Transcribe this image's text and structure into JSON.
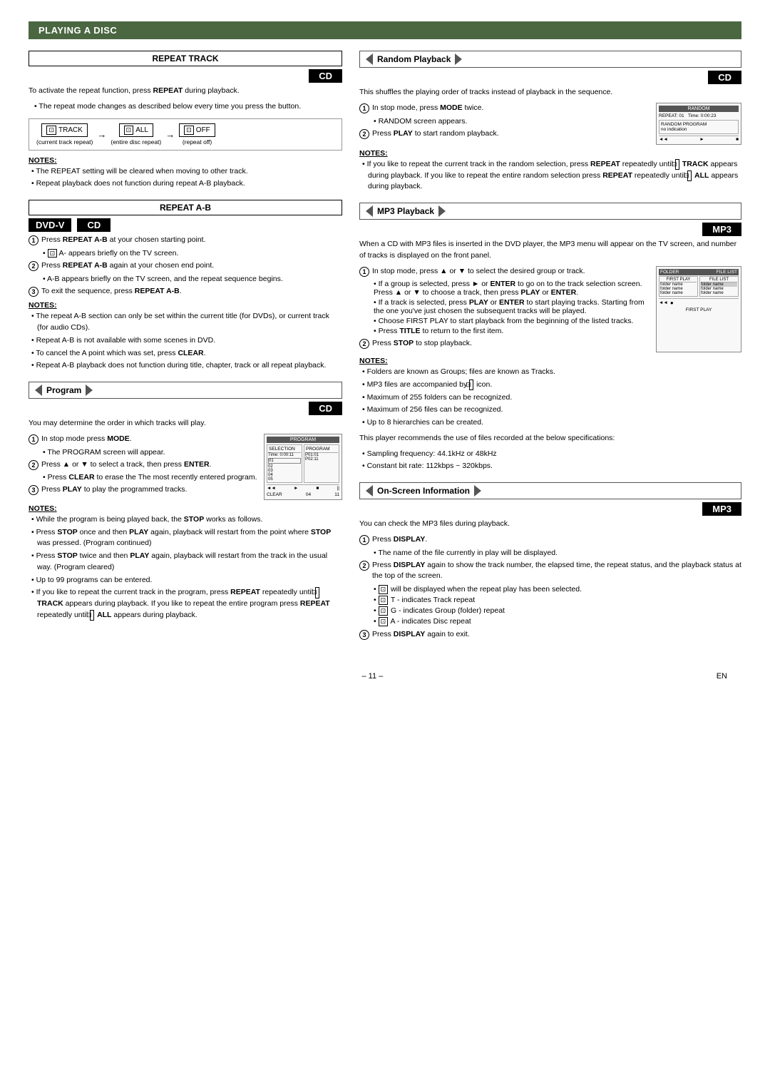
{
  "page": {
    "title": "PLAYING A DISC",
    "footer": "– 11 –",
    "footer_lang": "EN"
  },
  "left_col": {
    "repeat_track": {
      "header": "REPEAT TRACK",
      "badge": "CD",
      "intro": "To activate the repeat function, press REPEAT during playback.",
      "bullet1": "The repeat mode changes as described below every time you press the button.",
      "diagram": {
        "item1_icon": "⊡",
        "item1_label": "TRACK",
        "item1_sub": "(current track repeat)",
        "arrow1": "→",
        "item2_icon": "⊡",
        "item2_label": "ALL",
        "item2_sub": "(entire disc repeat)",
        "arrow2": "→",
        "item3_icon": "⊡",
        "item3_label": "OFF",
        "item3_sub": "(repeat off)"
      },
      "notes_label": "NOTES:",
      "note1": "The REPEAT setting will be cleared when moving to other track.",
      "note2": "Repeat playback does not function during repeat A-B playback."
    },
    "repeat_ab": {
      "header": "REPEAT A-B",
      "badges": [
        "DVD-V",
        "CD"
      ],
      "step1": "Press REPEAT A-B at your chosen starting point.",
      "step1b": "⊡ A- appears briefly on the TV screen.",
      "step2": "Press REPEAT A-B again at your chosen end point.",
      "step2b": "A-B appears briefly on the TV screen, and the repeat sequence begins.",
      "step3": "To exit the sequence, press REPEAT A-B.",
      "notes_label": "NOTES:",
      "note1": "The repeat A-B section can only be set within the current title (for DVDs), or current track (for audio CDs).",
      "note2": "Repeat A-B is not available with some scenes in DVD.",
      "note3": "To cancel the A point which was set, press CLEAR.",
      "note4": "Repeat A-B playback does not function during title, chapter, track or all repeat playback."
    },
    "program": {
      "header": "Program",
      "badge": "CD",
      "intro": "You may determine the order in which tracks will play.",
      "step1": "In stop mode press MODE.",
      "step1b": "The PROGRAM screen will appear.",
      "step2": "Press ▲ or ▼ to select a track, then press ENTER.",
      "step2b": "Press CLEAR to erase the The most recently entered program.",
      "step3": "Press PLAY to play the programmed tracks.",
      "notes_label": "NOTES:",
      "note1": "While the program is being played back, the STOP works as follows.",
      "note2": "Press STOP once and then PLAY again, playback will restart from the point where STOP was pressed. (Program continued)",
      "note3": "Press STOP twice and then PLAY again, playback will restart from the track in the usual way. (Program cleared)",
      "note4": "Up to 99 programs can be entered.",
      "note5": "If you like to repeat the current track in the program, press REPEAT repeatedly until ⊡ TRACK appears during playback. If you like to repeat the entire program press REPEAT repeatedly until ⊡ ALL appears during playback."
    }
  },
  "right_col": {
    "random_playback": {
      "header": "Random Playback",
      "badge": "CD",
      "intro": "This shuffles the playing order of tracks instead of playback in the sequence.",
      "step1": "In stop mode, press MODE twice.",
      "step1b": "RANDOM screen appears.",
      "step2": "Press PLAY to start random playback.",
      "notes_label": "NOTES:",
      "note1": "If you like to repeat the current track in the random selection, press REPEAT repeatedly until ⊡ TRACK appears during playback. If you like to repeat the entire random selection press REPEAT repeatedly until ⊡ ALL appears during playback.",
      "screen": {
        "line1": "RANDOM",
        "line2": "REPEAT: 01  Time: 0:00:23",
        "line3": "RANDOM PROGRAM",
        "line4": "no indication"
      }
    },
    "mp3_playback": {
      "header": "MP3 Playback",
      "badge": "MP3",
      "intro": "When a CD with MP3 files is inserted in the DVD player, the MP3 menu will appear on the TV screen, and number of tracks is displayed on the front panel.",
      "step1": "In stop mode, press ▲ or ▼ to select the desired group or track.",
      "step1_bullets": [
        "If a group is selected, press ► or ENTER to go on to the track selection screen. Press ▲ or ▼ to choose a track, then press PLAY or ENTER.",
        "If a track is selected, press PLAY or ENTER to start playing tracks. Starting from the one you've just chosen the subsequent tracks will be played.",
        "Choose FIRST PLAY to start playback from the beginning of the listed tracks.",
        "Press TITLE to return to the first item."
      ],
      "step2": "Press STOP to stop playback.",
      "notes_label": "NOTES:",
      "notes": [
        "Folders are known as Groups; files are known as Tracks.",
        "MP3 files are accompanied by ⊡ icon.",
        "Maximum of 255 folders can be recognized.",
        "Maximum of 256 files can be recognized.",
        "Up to 8 hierarchies can be created."
      ],
      "spec_intro": "This player recommends the use of files recorded at the below specifications:",
      "spec1": "Sampling frequency: 44.1kHz or 48kHz",
      "spec2": "Constant bit rate: 112kbps ~ 320kbps.",
      "screen": {
        "header_left": "FOLDER",
        "header_right": "FILE LIST",
        "row1": "FIRST PLAY",
        "rows": [
          "folder name",
          "folder name",
          "folder name"
        ],
        "file_rows": [
          "folder name",
          "folder name",
          "folder name"
        ],
        "footer": "FIRST PLAY"
      }
    },
    "onscreen_info": {
      "header": "On-Screen Information",
      "badge": "MP3",
      "intro": "You can check the MP3 files during playback.",
      "step1": "Press DISPLAY.",
      "step1b": "The name of the file currently in play will be displayed.",
      "step2": "Press DISPLAY again to show the track number, the elapsed time, the repeat status, and the playback status at the top of the screen.",
      "step2_bullets": [
        "⊡ will be displayed when the repeat play has been selected.",
        "⊡ T - indicates Track repeat",
        "⊡ G - indicates Group (folder) repeat",
        "⊡ A - indicates Disc repeat"
      ],
      "step3": "Press DISPLAY again to exit."
    }
  }
}
